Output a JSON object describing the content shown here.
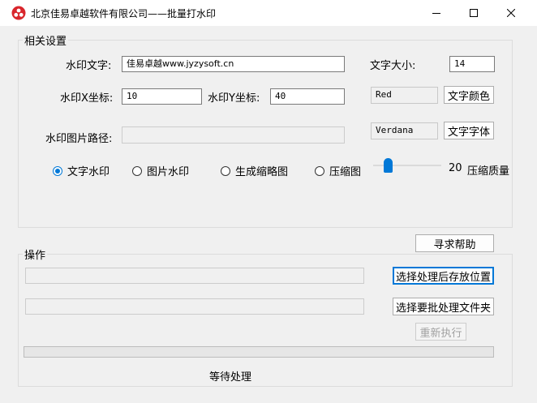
{
  "window": {
    "title": "北京佳易卓越软件有限公司——批量打水印"
  },
  "settings": {
    "group_label": "相关设置",
    "watermark_text_label": "水印文字:",
    "watermark_text_value": "佳易卓越www.jyzysoft.cn",
    "x_label": "水印X坐标:",
    "x_value": "10",
    "y_label": "水印Y坐标:",
    "y_value": "40",
    "image_path_label": "水印图片路径:",
    "image_path_value": "",
    "font_size_label": "文字大小:",
    "font_size_value": "14",
    "color_value": "Red",
    "color_button": "文字颜色",
    "font_value": "Verdana",
    "font_button": "文字字体",
    "radio_text": "文字水印",
    "radio_image": "图片水印",
    "radio_thumb": "生成缩略图",
    "radio_compress": "压缩图",
    "quality_value": "20",
    "quality_label": "压缩质量",
    "quality_slider_fraction": 0.2
  },
  "help_button": "寻求帮助",
  "operations": {
    "group_label": "操作",
    "output_path_value": "",
    "source_path_value": "",
    "select_output_button": "选择处理后存放位置",
    "select_source_button": "选择要批处理文件夹",
    "rerun_button": "重新执行",
    "progress_fraction": 0,
    "status_text": "等待处理"
  },
  "colors": {
    "accent": "#0078d7",
    "icon_red": "#d9262c"
  }
}
